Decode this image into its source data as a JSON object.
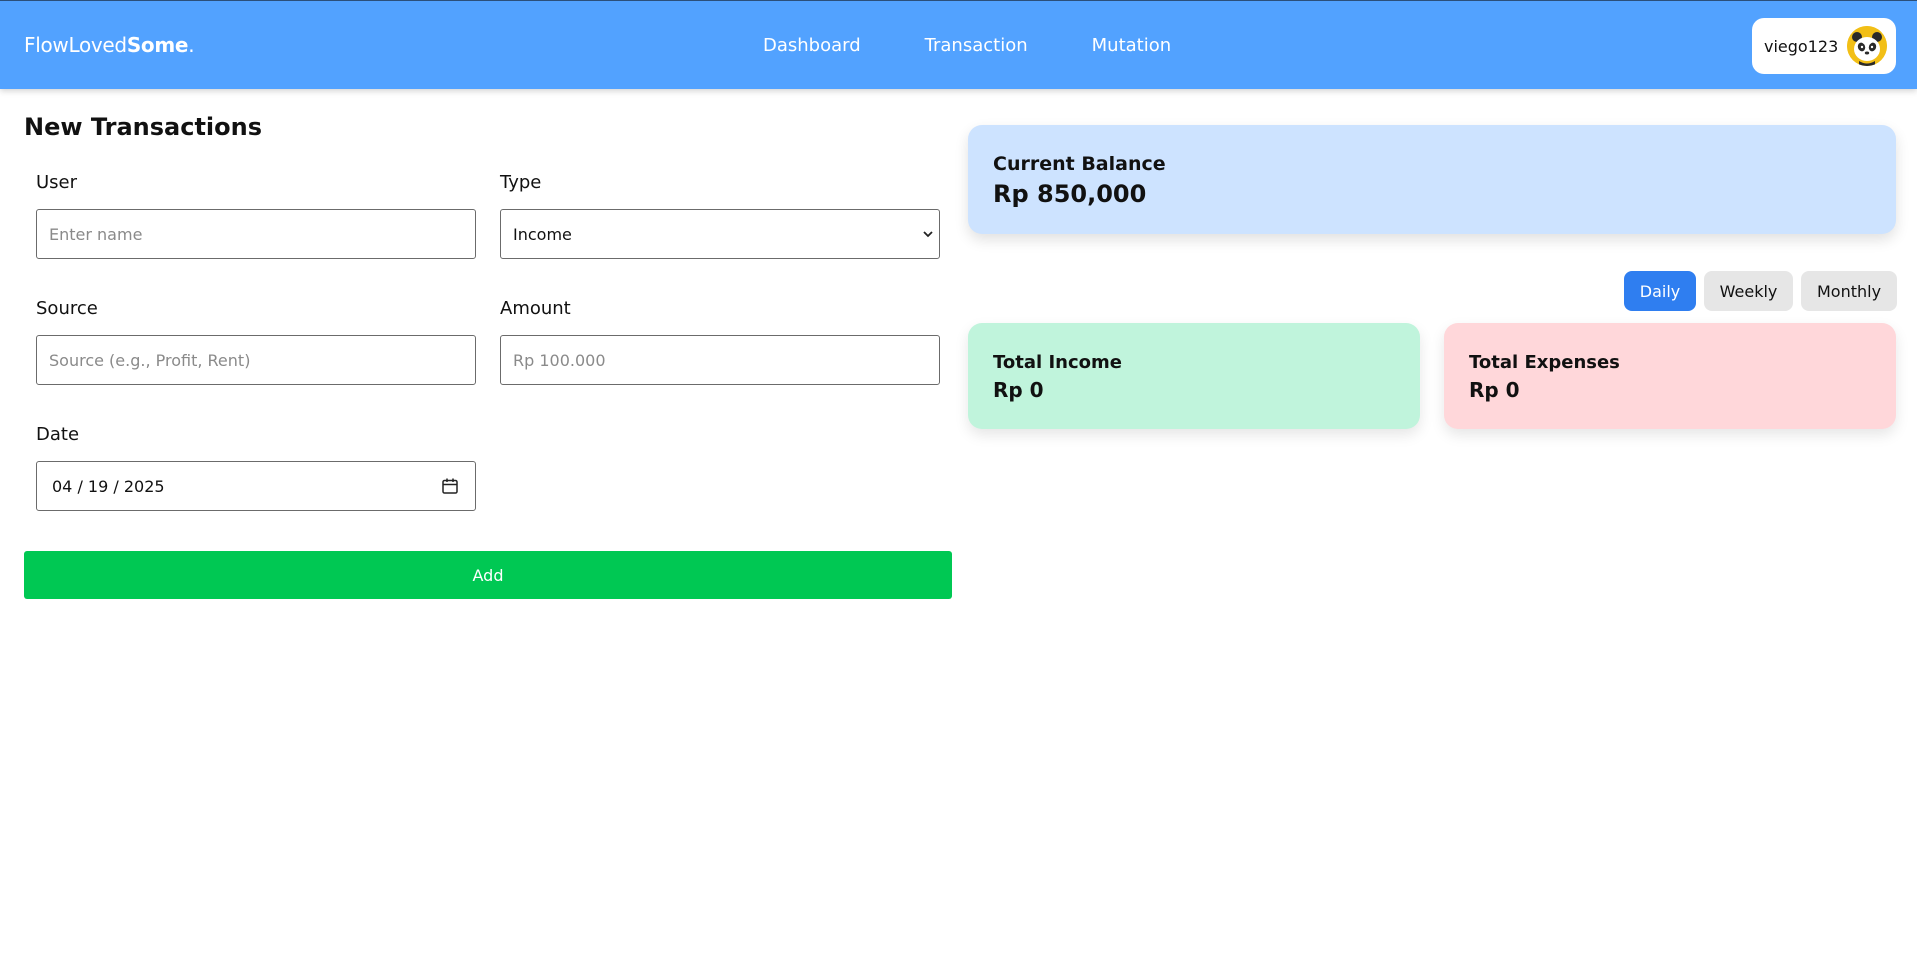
{
  "nav": {
    "brand_part1": "FlowLoved",
    "brand_part2": "Some",
    "brand_part3": ".",
    "links": [
      "Dashboard",
      "Transaction",
      "Mutation"
    ],
    "username": "viego123",
    "avatar_icon": "panda-avatar-icon"
  },
  "form": {
    "title": "New Transactions",
    "user_label": "User",
    "user_placeholder": "Enter name",
    "type_label": "Type",
    "type_value": "Income",
    "source_label": "Source",
    "source_placeholder": "Source (e.g., Profit, Rent)",
    "amount_label": "Amount",
    "amount_placeholder": "Rp 100.000",
    "date_label": "Date",
    "date_value": "04 / 19 / 2025",
    "add_label": "Add"
  },
  "summary": {
    "balance_label": "Current Balance",
    "balance_value": "Rp 850,000",
    "periods": [
      "Daily",
      "Weekly",
      "Monthly"
    ],
    "active_period": "Daily",
    "income_label": "Total Income",
    "income_value": "Rp 0",
    "expense_label": "Total Expenses",
    "expense_value": "Rp 0"
  },
  "colors": {
    "navbar": "#52a2ff",
    "add_button": "#00c853",
    "balance_card": "#cde3ff",
    "income_card": "#c0f4dc",
    "expense_card": "#ffd7da",
    "active_toggle": "#2f7ef0"
  }
}
